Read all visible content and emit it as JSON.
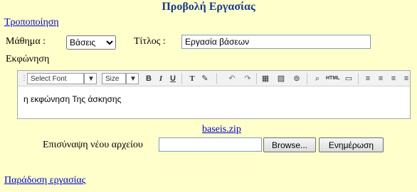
{
  "page_title": "Προβολή Εργασίας",
  "edit_link": "Τροποποίηση",
  "subject": {
    "label": "Μάθημα :",
    "value": "Βάσεις"
  },
  "title_field": {
    "label": "Τίτλος :",
    "value": "Εργασία βάσεων"
  },
  "statement": {
    "label": "Εκφώνηση",
    "toolbar": {
      "font_select": "Select Font",
      "size_select": "Size",
      "html_button": "HTML"
    },
    "content": "η εκφώνηση Της άσκησης"
  },
  "attachment": {
    "file_link": "baseis.zip",
    "new_file_label": "Επισύναψη νέου αρχείου",
    "browse_button": "Browse...",
    "update_button": "Ενημέρωση"
  },
  "submit_link": "Παράδοση εργασίας"
}
